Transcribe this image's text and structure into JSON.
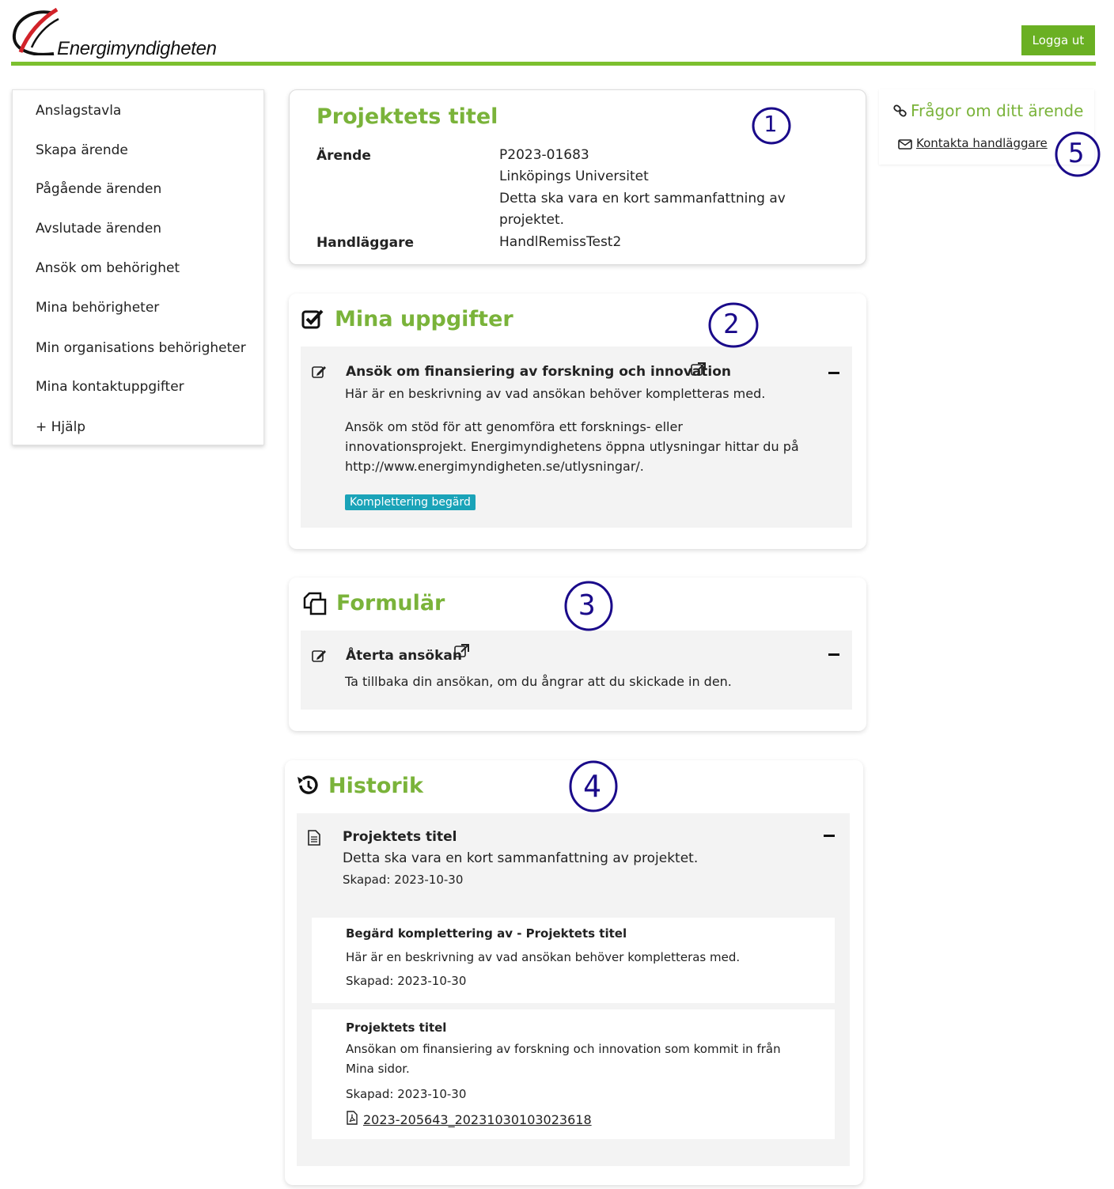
{
  "header": {
    "logo_text": "Energimyndigheten",
    "logout_label": "Logga ut"
  },
  "nav": {
    "items": [
      {
        "label": "Anslagstavla"
      },
      {
        "label": "Skapa ärende"
      },
      {
        "label": "Pågående ärenden"
      },
      {
        "label": "Avslutade ärenden"
      },
      {
        "label": "Ansök om behörighet"
      },
      {
        "label": "Mina behörigheter"
      },
      {
        "label": "Min organisations behörigheter"
      },
      {
        "label": "Mina kontaktuppgifter"
      },
      {
        "label": "+ Hjälp"
      }
    ]
  },
  "project": {
    "title": "Projektets titel",
    "arende_label": "Ärende",
    "arende_number": "P2023-01683",
    "organization": "Linköpings Universitet",
    "summary": "Detta ska vara en kort sammanfattning av projektet.",
    "handlaggare_label": "Handläggare",
    "handlaggare": "HandlRemissTest2"
  },
  "tasks": {
    "title": "Mina uppgifter",
    "items": [
      {
        "title": "Ansök om finansiering av forskning och innovation",
        "description": "Här är en beskrivning av vad ansökan behöver kompletteras med.",
        "details": "Ansök om stöd för att genomföra ett forsknings- eller innovationsprojekt. Energimyndighetens öppna utlysningar hittar du på http://www.energimyndigheten.se/utlysningar/.",
        "badge": "Komplettering begärd"
      }
    ]
  },
  "forms": {
    "title": "Formulär",
    "items": [
      {
        "title": "Återta ansökan",
        "description": "Ta tillbaka din ansökan, om du ångrar att du skickade in den."
      }
    ]
  },
  "history": {
    "title": "Historik",
    "main": {
      "title": "Projektets titel",
      "summary": "Detta ska vara en kort sammanfattning av projektet.",
      "created": "Skapad: 2023-10-30"
    },
    "entries": [
      {
        "title": "Begärd komplettering av - Projektets titel",
        "description": "Här är en beskrivning av vad ansökan behöver kompletteras med.",
        "created": "Skapad: 2023-10-30"
      },
      {
        "title": "Projektets titel",
        "description": "Ansökan om finansiering av forskning och innovation som kommit in från Mina sidor.",
        "created": "Skapad: 2023-10-30",
        "file": "2023-205643_20231030103023618"
      }
    ]
  },
  "sidebar": {
    "title": "Frågor om ditt ärende",
    "contact_link": "Kontakta handläggare"
  },
  "annotations": [
    "1",
    "2",
    "3",
    "4",
    "5"
  ],
  "colors": {
    "brand_green": "#6ab023",
    "title_green": "#7ab33a",
    "badge_teal": "#1aa3b8",
    "annotation_ink": "#1a0a8a",
    "logo_red": "#d2232a"
  }
}
